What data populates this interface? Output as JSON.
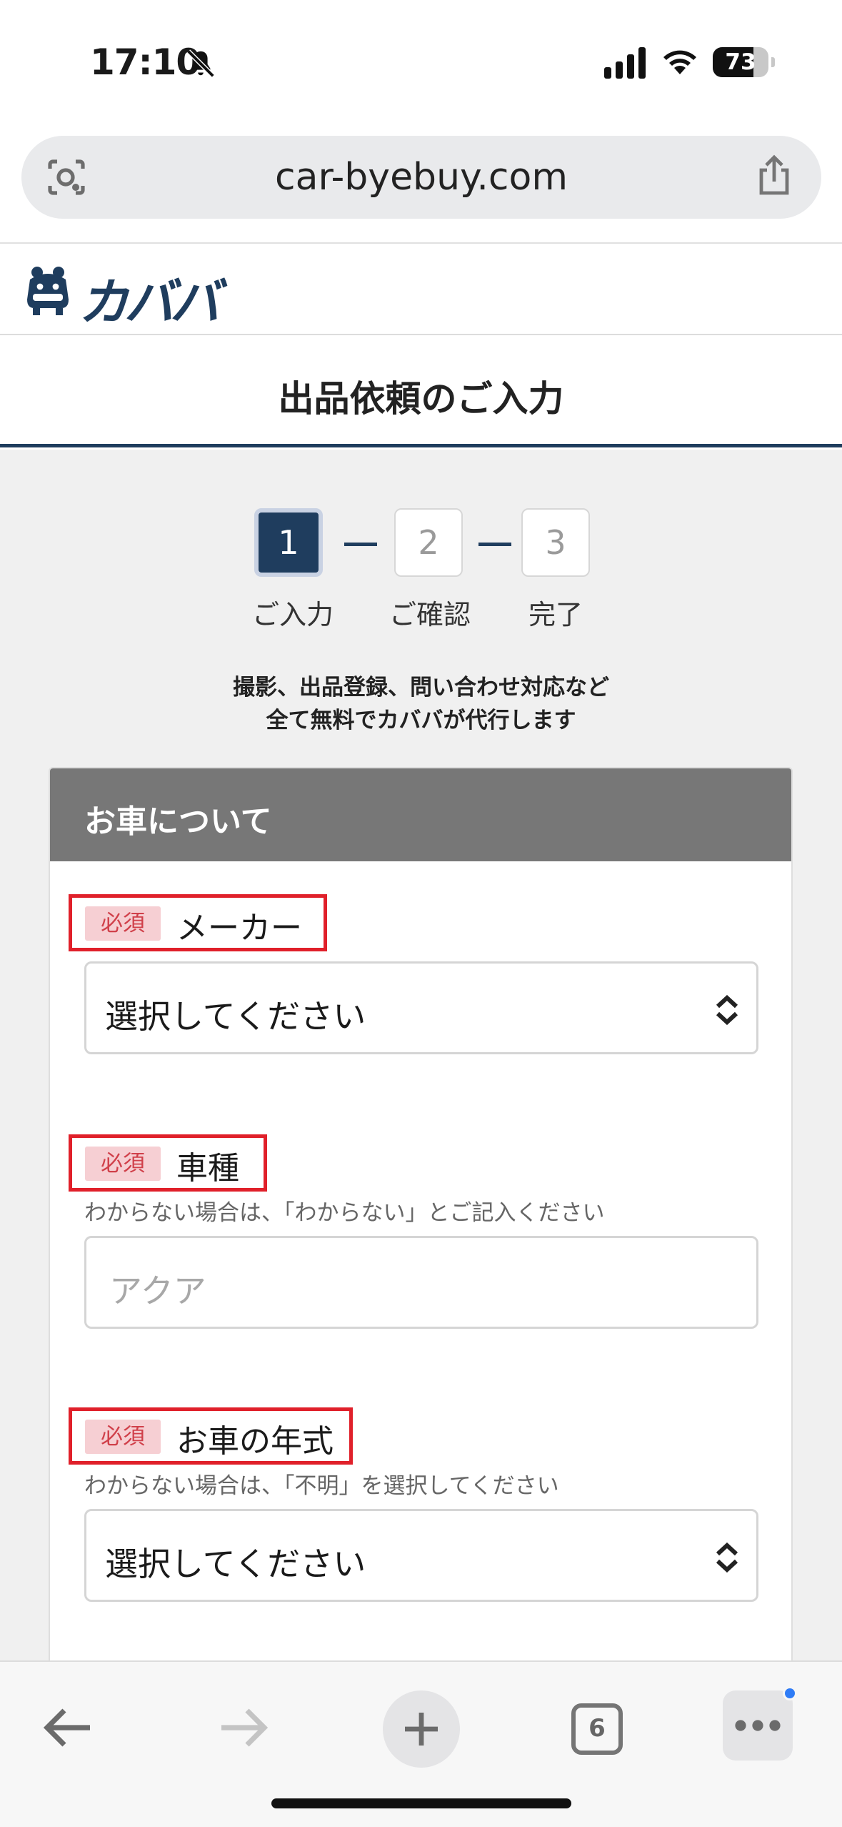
{
  "status_bar": {
    "time": "17:10",
    "battery_percent": "73",
    "battery_level": 0.73,
    "icons": [
      "bell-slash-icon",
      "signal-icon",
      "wifi-icon",
      "battery-icon"
    ]
  },
  "browser": {
    "url": "car-byebuy.com",
    "icons": [
      "lens-icon",
      "share-icon"
    ]
  },
  "site": {
    "logo_text": "カババ",
    "logo_icon": "hippo-car-icon",
    "brand_color": "#1f3d5e"
  },
  "page": {
    "title": "出品依頼のご入力"
  },
  "steps": [
    {
      "number": "1",
      "label": "ご入力",
      "active": true
    },
    {
      "number": "2",
      "label": "ご確認",
      "active": false
    },
    {
      "number": "3",
      "label": "完了",
      "active": false
    }
  ],
  "intro": {
    "line1": "撮影、出品登録、問い合わせ対応など",
    "line2": "全て無料でカババが代行します"
  },
  "form": {
    "section_title": "お車について",
    "required_badge": "必須",
    "fields": [
      {
        "label": "メーカー",
        "type": "select",
        "value": "選択してください",
        "hint": ""
      },
      {
        "label": "車種",
        "type": "text",
        "placeholder": "アクア",
        "hint": "わからない場合は、「わからない」とご記入ください"
      },
      {
        "label": "お車の年式",
        "type": "select",
        "value": "選択してください",
        "hint": "わからない場合は、「不明」を選択してください"
      }
    ],
    "highlight_color": "#e0202a",
    "badge_color": "#f6cfd3"
  },
  "toolbar": {
    "tab_count": "6",
    "icons": [
      "back-arrow-icon",
      "forward-arrow-icon",
      "plus-icon",
      "tabs-icon",
      "more-icon"
    ]
  }
}
